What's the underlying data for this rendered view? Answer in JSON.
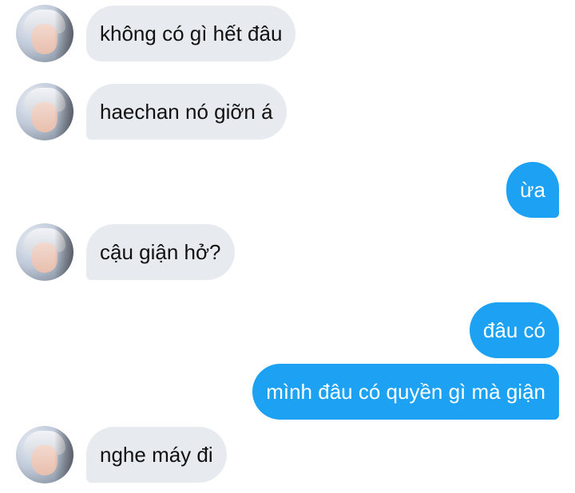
{
  "messages": [
    {
      "direction": "incoming",
      "text": "không có gì hết đâu"
    },
    {
      "direction": "incoming",
      "text": "haechan nó giỡn á"
    },
    {
      "direction": "outgoing",
      "text": "ừa"
    },
    {
      "direction": "incoming",
      "text": "cậu giận hở?"
    },
    {
      "direction": "outgoing",
      "text": "đâu có"
    },
    {
      "direction": "outgoing",
      "text": "mình đâu có quyền gì mà giận"
    },
    {
      "direction": "incoming",
      "text": "nghe máy đi"
    }
  ],
  "colors": {
    "outgoing_bubble": "#1da1f2",
    "incoming_bubble": "#e7ebef",
    "incoming_text": "#111111",
    "outgoing_text": "#ffffff"
  },
  "icons": {
    "avatar": "contact-avatar-photo"
  }
}
